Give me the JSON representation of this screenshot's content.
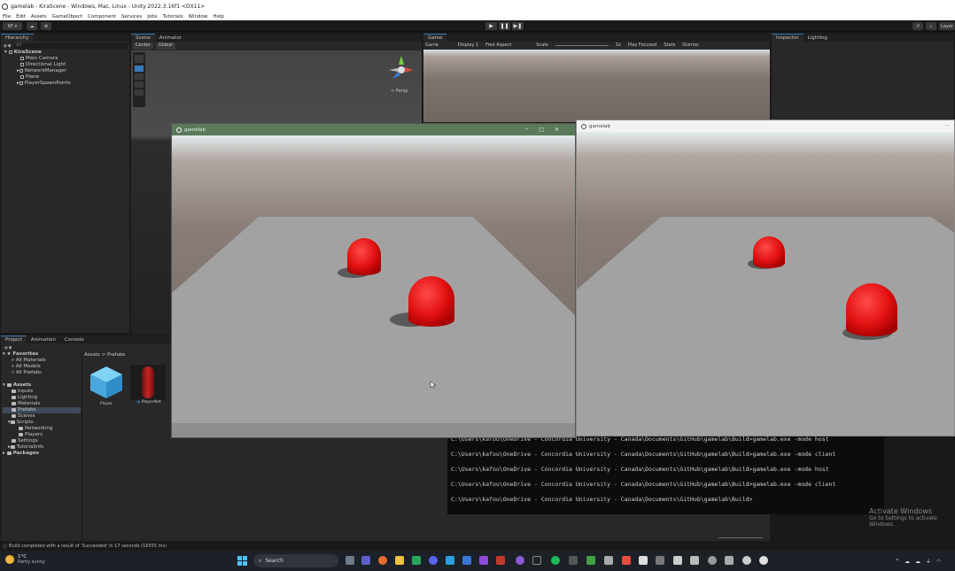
{
  "window": {
    "title": "gamelab - KiraScene - Windows, Mac, Linux - Unity 2022.3.16f1 <DX11>",
    "menu": [
      "File",
      "Edit",
      "Assets",
      "GameObject",
      "Component",
      "Services",
      "Jobs",
      "Tutorials",
      "Window",
      "Help"
    ]
  },
  "toolbar": {
    "account": "KF",
    "right_tab": "Layer"
  },
  "hierarchy": {
    "tab": "Hierarchy",
    "search_placeholder": "All",
    "scene": "KiraScene",
    "items": [
      "Main Camera",
      "Directional Light",
      "NetworkManager",
      "Plane",
      "PlayerSpawnPoints"
    ]
  },
  "scene_view": {
    "tabs": [
      "Scene",
      "Animator"
    ],
    "pivot": "Center",
    "space": "Global",
    "persp_label": "< Persp"
  },
  "game_view": {
    "tab": "Game",
    "mode": "Game",
    "display": "Display 1",
    "aspect": "Free Aspect",
    "scale_label": "Scale",
    "scale_value": "1x",
    "play_mode": "Play Focused",
    "stats": "Stats",
    "gizmos": "Gizmos"
  },
  "inspector": {
    "tabs": [
      "Inspector",
      "Lighting"
    ]
  },
  "project": {
    "tabs": [
      "Project",
      "Animation",
      "Console"
    ],
    "favorites_label": "Favorites",
    "favorites": [
      "All Materials",
      "All Models",
      "All Prefabs"
    ],
    "assets_label": "Assets",
    "assets": [
      "Inputs",
      "Lighting",
      "Materials",
      "Prefabs",
      "Scenes",
      "Scripts"
    ],
    "scripts_children": [
      "Networking",
      "Players"
    ],
    "assets_more": [
      "Settings",
      "TutorialInfo"
    ],
    "packages_label": "Packages",
    "breadcrumb_root": "Assets",
    "breadcrumb_current": "Prefabs",
    "prefabs": [
      "Player",
      "PlayerNet"
    ]
  },
  "game_window_left": {
    "title": "gamelab",
    "colors": {
      "titlebar": "#5a7a5a"
    }
  },
  "game_window_right": {
    "title": "gamelab"
  },
  "console": {
    "lines": [
      "C:\\Users\\kafou\\OneDrive - Concordia University - Canada\\Documents\\GitHub\\gamelab\\Build>gamelab.exe -mode host",
      "C:\\Users\\kafou\\OneDrive - Concordia University - Canada\\Documents\\GitHub\\gamelab\\Build>gamelab.exe -mode client",
      "C:\\Users\\kafou\\OneDrive - Concordia University - Canada\\Documents\\GitHub\\gamelab\\Build>gamelab.exe -mode host",
      "C:\\Users\\kafou\\OneDrive - Concordia University - Canada\\Documents\\GitHub\\gamelab\\Build>gamelab.exe -mode client",
      "C:\\Users\\kafou\\OneDrive - Concordia University - Canada\\Documents\\GitHub\\gamelab\\Build>"
    ]
  },
  "watermark": {
    "line1": "Activate Windows",
    "line2": "Go to Settings to activate Windows."
  },
  "status": {
    "message": "Build completed with a result of 'Succeeded' in 17 seconds (16555 ms)"
  },
  "taskbar": {
    "temperature": "1°C",
    "weather": "Partly sunny",
    "search_placeholder": "Search"
  },
  "colors": {
    "accent": "#3a79bb",
    "sphere": "#e01414",
    "console_bg": "#0c0c0c"
  }
}
